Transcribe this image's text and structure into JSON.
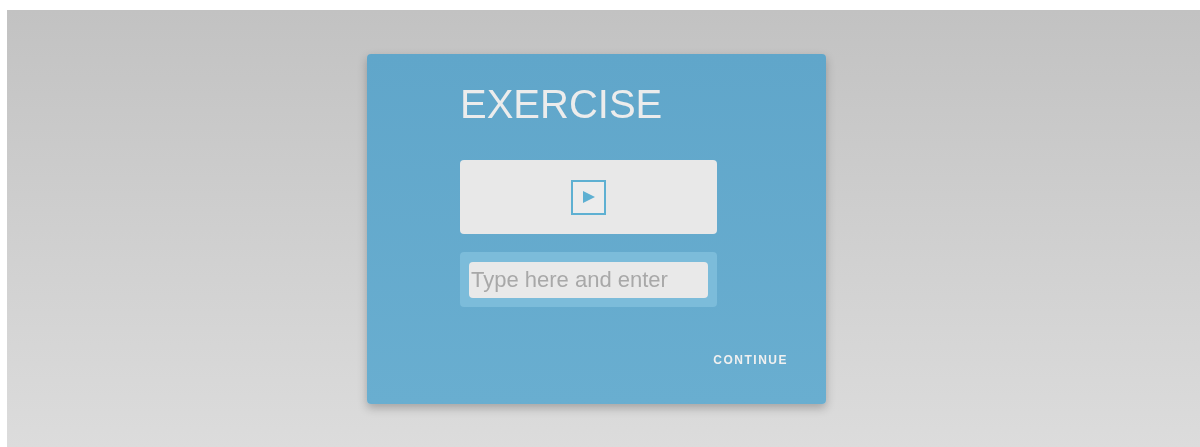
{
  "title": "EXERCISE",
  "audio": {
    "playing": false
  },
  "answer": {
    "placeholder": "Type here and enter"
  },
  "buttons": [
    {
      "label": "CONTINUE"
    }
  ]
}
